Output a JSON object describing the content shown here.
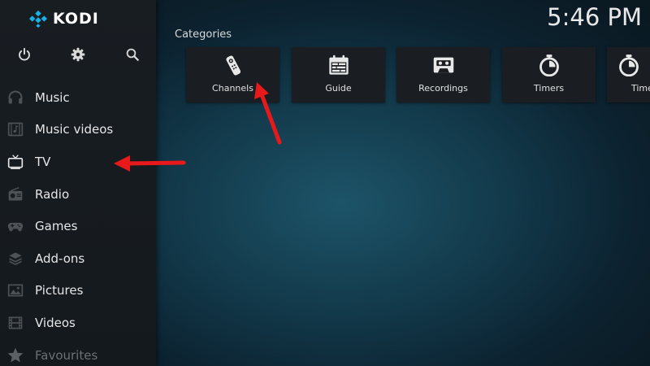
{
  "app": {
    "logo_text": "KODI",
    "clock": "5:46 PM"
  },
  "top_icons": [
    {
      "icon": "power-icon"
    },
    {
      "icon": "gear-icon"
    },
    {
      "icon": "search-icon"
    }
  ],
  "sidebar": {
    "items": [
      {
        "label": "Music",
        "icon": "headphones-icon"
      },
      {
        "label": "Music videos",
        "icon": "music-video-icon"
      },
      {
        "label": "TV",
        "icon": "tv-icon"
      },
      {
        "label": "Radio",
        "icon": "radio-icon"
      },
      {
        "label": "Games",
        "icon": "gamepad-icon"
      },
      {
        "label": "Add-ons",
        "icon": "addons-icon"
      },
      {
        "label": "Pictures",
        "icon": "pictures-icon"
      },
      {
        "label": "Videos",
        "icon": "film-icon"
      },
      {
        "label": "Favourites",
        "icon": "star-icon"
      }
    ]
  },
  "main": {
    "categories_heading": "Categories",
    "tiles": [
      {
        "label": "Channels",
        "icon": "remote-icon"
      },
      {
        "label": "Guide",
        "icon": "calendar-icon"
      },
      {
        "label": "Recordings",
        "icon": "cassette-icon"
      },
      {
        "label": "Timers",
        "icon": "stopwatch-icon"
      },
      {
        "label": "Timer",
        "icon": "stopwatch-icon"
      }
    ]
  },
  "colors": {
    "accent_arrow": "#e8191b",
    "logo_blue": "#17b2e7",
    "sidebar_bg": "#181d22",
    "tile_bg": "#1a1e22"
  }
}
